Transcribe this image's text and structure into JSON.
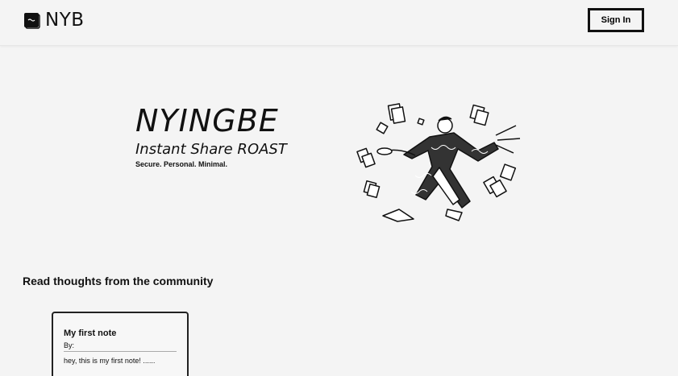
{
  "header": {
    "logo_text": "NYB",
    "signin_label": "Sign In"
  },
  "hero": {
    "title": "NYINGBE",
    "subtitle": "Instant Share ROAST",
    "tagline": "Secure. Personal. Minimal."
  },
  "community": {
    "section_title": "Read thoughts from the community",
    "notes": [
      {
        "title": "My first note",
        "by_label": "By:",
        "preview": "hey, this is my first note! ......"
      }
    ]
  },
  "icons": {
    "logo": "notebook-icon",
    "illustration": "man-with-flying-papers-illustration"
  }
}
